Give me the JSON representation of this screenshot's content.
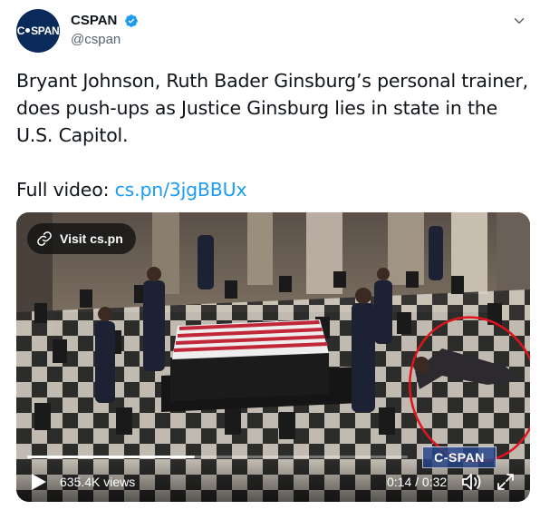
{
  "account": {
    "avatar_text_left": "C",
    "avatar_text_right": "SPAN",
    "display_name": "CSPAN",
    "handle": "@cspan",
    "verified": true
  },
  "tweet": {
    "text": "Bryant Johnson, Ruth Bader Ginsburg’s personal trainer, does push-ups as Justice Ginsburg lies in state in the U.S. Capitol.",
    "video_prefix": "Full video: ",
    "link_text": "cs.pn/3jgBBUx"
  },
  "media": {
    "visit_label": "Visit cs.pn",
    "watermark": "C-SPAN",
    "views": "635.4K views",
    "time": "0:14 / 0:32",
    "progress": 0.44
  },
  "icons": {
    "verified": "verified-badge-icon",
    "more": "chevron-down-icon",
    "link": "link-icon",
    "play": "play-icon",
    "volume": "volume-icon",
    "fullscreen": "fullscreen-icon"
  },
  "colors": {
    "link": "#1d9bf0",
    "verified": "#1d9bf0",
    "avatar_bg": "#0a2a59",
    "annotation_circle": "#e0141e"
  }
}
